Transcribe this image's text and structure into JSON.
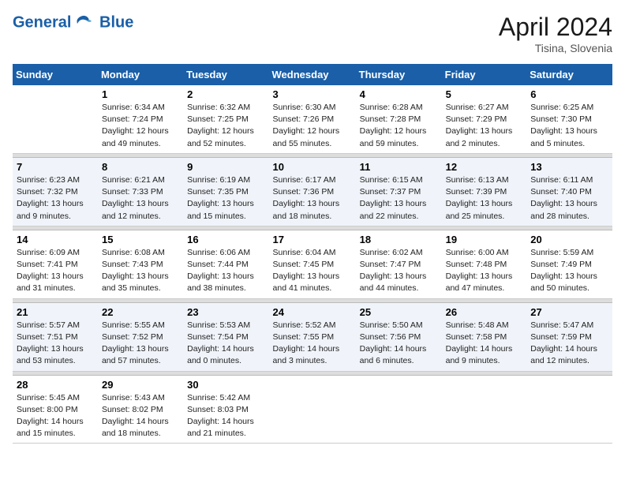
{
  "header": {
    "logo_line1": "General",
    "logo_line2": "Blue",
    "month": "April 2024",
    "location": "Tisina, Slovenia"
  },
  "weekdays": [
    "Sunday",
    "Monday",
    "Tuesday",
    "Wednesday",
    "Thursday",
    "Friday",
    "Saturday"
  ],
  "weeks": [
    [
      {
        "num": "",
        "sunrise": "",
        "sunset": "",
        "daylight": ""
      },
      {
        "num": "1",
        "sunrise": "Sunrise: 6:34 AM",
        "sunset": "Sunset: 7:24 PM",
        "daylight": "Daylight: 12 hours and 49 minutes."
      },
      {
        "num": "2",
        "sunrise": "Sunrise: 6:32 AM",
        "sunset": "Sunset: 7:25 PM",
        "daylight": "Daylight: 12 hours and 52 minutes."
      },
      {
        "num": "3",
        "sunrise": "Sunrise: 6:30 AM",
        "sunset": "Sunset: 7:26 PM",
        "daylight": "Daylight: 12 hours and 55 minutes."
      },
      {
        "num": "4",
        "sunrise": "Sunrise: 6:28 AM",
        "sunset": "Sunset: 7:28 PM",
        "daylight": "Daylight: 12 hours and 59 minutes."
      },
      {
        "num": "5",
        "sunrise": "Sunrise: 6:27 AM",
        "sunset": "Sunset: 7:29 PM",
        "daylight": "Daylight: 13 hours and 2 minutes."
      },
      {
        "num": "6",
        "sunrise": "Sunrise: 6:25 AM",
        "sunset": "Sunset: 7:30 PM",
        "daylight": "Daylight: 13 hours and 5 minutes."
      }
    ],
    [
      {
        "num": "7",
        "sunrise": "Sunrise: 6:23 AM",
        "sunset": "Sunset: 7:32 PM",
        "daylight": "Daylight: 13 hours and 9 minutes."
      },
      {
        "num": "8",
        "sunrise": "Sunrise: 6:21 AM",
        "sunset": "Sunset: 7:33 PM",
        "daylight": "Daylight: 13 hours and 12 minutes."
      },
      {
        "num": "9",
        "sunrise": "Sunrise: 6:19 AM",
        "sunset": "Sunset: 7:35 PM",
        "daylight": "Daylight: 13 hours and 15 minutes."
      },
      {
        "num": "10",
        "sunrise": "Sunrise: 6:17 AM",
        "sunset": "Sunset: 7:36 PM",
        "daylight": "Daylight: 13 hours and 18 minutes."
      },
      {
        "num": "11",
        "sunrise": "Sunrise: 6:15 AM",
        "sunset": "Sunset: 7:37 PM",
        "daylight": "Daylight: 13 hours and 22 minutes."
      },
      {
        "num": "12",
        "sunrise": "Sunrise: 6:13 AM",
        "sunset": "Sunset: 7:39 PM",
        "daylight": "Daylight: 13 hours and 25 minutes."
      },
      {
        "num": "13",
        "sunrise": "Sunrise: 6:11 AM",
        "sunset": "Sunset: 7:40 PM",
        "daylight": "Daylight: 13 hours and 28 minutes."
      }
    ],
    [
      {
        "num": "14",
        "sunrise": "Sunrise: 6:09 AM",
        "sunset": "Sunset: 7:41 PM",
        "daylight": "Daylight: 13 hours and 31 minutes."
      },
      {
        "num": "15",
        "sunrise": "Sunrise: 6:08 AM",
        "sunset": "Sunset: 7:43 PM",
        "daylight": "Daylight: 13 hours and 35 minutes."
      },
      {
        "num": "16",
        "sunrise": "Sunrise: 6:06 AM",
        "sunset": "Sunset: 7:44 PM",
        "daylight": "Daylight: 13 hours and 38 minutes."
      },
      {
        "num": "17",
        "sunrise": "Sunrise: 6:04 AM",
        "sunset": "Sunset: 7:45 PM",
        "daylight": "Daylight: 13 hours and 41 minutes."
      },
      {
        "num": "18",
        "sunrise": "Sunrise: 6:02 AM",
        "sunset": "Sunset: 7:47 PM",
        "daylight": "Daylight: 13 hours and 44 minutes."
      },
      {
        "num": "19",
        "sunrise": "Sunrise: 6:00 AM",
        "sunset": "Sunset: 7:48 PM",
        "daylight": "Daylight: 13 hours and 47 minutes."
      },
      {
        "num": "20",
        "sunrise": "Sunrise: 5:59 AM",
        "sunset": "Sunset: 7:49 PM",
        "daylight": "Daylight: 13 hours and 50 minutes."
      }
    ],
    [
      {
        "num": "21",
        "sunrise": "Sunrise: 5:57 AM",
        "sunset": "Sunset: 7:51 PM",
        "daylight": "Daylight: 13 hours and 53 minutes."
      },
      {
        "num": "22",
        "sunrise": "Sunrise: 5:55 AM",
        "sunset": "Sunset: 7:52 PM",
        "daylight": "Daylight: 13 hours and 57 minutes."
      },
      {
        "num": "23",
        "sunrise": "Sunrise: 5:53 AM",
        "sunset": "Sunset: 7:54 PM",
        "daylight": "Daylight: 14 hours and 0 minutes."
      },
      {
        "num": "24",
        "sunrise": "Sunrise: 5:52 AM",
        "sunset": "Sunset: 7:55 PM",
        "daylight": "Daylight: 14 hours and 3 minutes."
      },
      {
        "num": "25",
        "sunrise": "Sunrise: 5:50 AM",
        "sunset": "Sunset: 7:56 PM",
        "daylight": "Daylight: 14 hours and 6 minutes."
      },
      {
        "num": "26",
        "sunrise": "Sunrise: 5:48 AM",
        "sunset": "Sunset: 7:58 PM",
        "daylight": "Daylight: 14 hours and 9 minutes."
      },
      {
        "num": "27",
        "sunrise": "Sunrise: 5:47 AM",
        "sunset": "Sunset: 7:59 PM",
        "daylight": "Daylight: 14 hours and 12 minutes."
      }
    ],
    [
      {
        "num": "28",
        "sunrise": "Sunrise: 5:45 AM",
        "sunset": "Sunset: 8:00 PM",
        "daylight": "Daylight: 14 hours and 15 minutes."
      },
      {
        "num": "29",
        "sunrise": "Sunrise: 5:43 AM",
        "sunset": "Sunset: 8:02 PM",
        "daylight": "Daylight: 14 hours and 18 minutes."
      },
      {
        "num": "30",
        "sunrise": "Sunrise: 5:42 AM",
        "sunset": "Sunset: 8:03 PM",
        "daylight": "Daylight: 14 hours and 21 minutes."
      },
      {
        "num": "",
        "sunrise": "",
        "sunset": "",
        "daylight": ""
      },
      {
        "num": "",
        "sunrise": "",
        "sunset": "",
        "daylight": ""
      },
      {
        "num": "",
        "sunrise": "",
        "sunset": "",
        "daylight": ""
      },
      {
        "num": "",
        "sunrise": "",
        "sunset": "",
        "daylight": ""
      }
    ]
  ]
}
